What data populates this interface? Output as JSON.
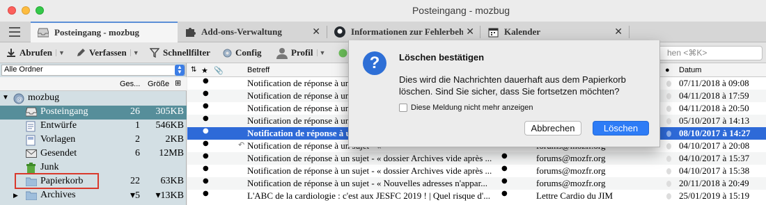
{
  "window": {
    "title": "Posteingang - mozbug"
  },
  "tabs": [
    {
      "label": "Posteingang - mozbug",
      "icon": "inbox-icon"
    },
    {
      "label": "Add-ons-Verwaltung",
      "icon": "puzzle-icon"
    },
    {
      "label": "Informationen zur Fehlerbeh",
      "icon": "github-icon"
    },
    {
      "label": "Kalender",
      "icon": "calendar-icon"
    }
  ],
  "tab_close": "✕",
  "toolbar": {
    "get_messages": "Abrufen",
    "write": "Verfassen",
    "quickfilter": "Schnellfilter",
    "config": "Config",
    "profile": "Profil",
    "search_placeholder": "hen <⌘K>"
  },
  "folders": {
    "select_value": "Alle Ordner",
    "header": {
      "name": "Ordner",
      "count": "Ges...",
      "size": "Größe"
    },
    "account": "mozbug",
    "items": [
      {
        "name": "Posteingang",
        "count": "26",
        "size": "305KB",
        "icon": "inbox-icon"
      },
      {
        "name": "Entwürfe",
        "count": "1",
        "size": "546KB",
        "icon": "drafts-icon"
      },
      {
        "name": "Vorlagen",
        "count": "2",
        "size": "2KB",
        "icon": "templates-icon"
      },
      {
        "name": "Gesendet",
        "count": "6",
        "size": "12MB",
        "icon": "sent-icon"
      },
      {
        "name": "Junk",
        "count": "",
        "size": "",
        "icon": "junk-icon"
      },
      {
        "name": "Papierkorb",
        "count": "22",
        "size": "63KB",
        "icon": "trash-folder-icon"
      },
      {
        "name": "Archives",
        "count": "▾5",
        "size": "▾13KB",
        "icon": "archive-folder-icon"
      }
    ]
  },
  "messages": {
    "header": {
      "subject": "Betreff",
      "date": "Datum"
    },
    "rows": [
      {
        "subject": "Notification de réponse à un sujet - « ",
        "sender": "",
        "date": "07/11/2018 à 09:08"
      },
      {
        "subject": "Notification de réponse à un sujet - « ",
        "sender": "",
        "date": "04/11/2018 à 17:59"
      },
      {
        "subject": "Notification de réponse à un sujet - « ",
        "sender": "",
        "date": "04/11/2018 à 20:50"
      },
      {
        "subject": "Notification de réponse à un sujet - « ",
        "sender": "",
        "date": "05/10/2017 à 14:13"
      },
      {
        "subject": "Notification de réponse à un sujet - « ",
        "sender": "",
        "date": "08/10/2017 à 14:27"
      },
      {
        "subject": "Notification de réponse à un sujet - « ",
        "sender": "forums@mozfr.org",
        "date": "04/10/2017 à 20:08"
      },
      {
        "subject": "Notification de réponse à un sujet - « dossier Archives vide après ...",
        "sender": "forums@mozfr.org",
        "date": "04/10/2017 à 15:37"
      },
      {
        "subject": "Notification de réponse à un sujet - « dossier Archives vide après ...",
        "sender": "forums@mozfr.org",
        "date": "04/10/2017 à 15:38"
      },
      {
        "subject": "Notification de réponse à un sujet - « Nouvelles adresses n'appar...",
        "sender": "forums@mozfr.org",
        "date": "20/11/2018 à 20:49"
      },
      {
        "subject": "L'ABC de la cardiologie : c'est aux JESFC 2019 ! | Quel risque d'...",
        "sender": "Lettre Cardio du JIM",
        "date": "25/01/2019 à 15:19"
      }
    ]
  },
  "dialog": {
    "title": "Löschen bestätigen",
    "message": "Dies wird die Nachrichten dauerhaft aus dem Papierkorb löschen. Sind Sie sicher, dass Sie fortsetzen möchten?",
    "checkbox": "Diese Meldung nicht mehr anzeigen",
    "cancel": "Abbrechen",
    "ok": "Löschen"
  },
  "colors": {
    "selection": "#2e6ad8",
    "folder_selected": "#568e9a",
    "highlight_box": "#d9392c",
    "accent": "#2e7cf6"
  }
}
